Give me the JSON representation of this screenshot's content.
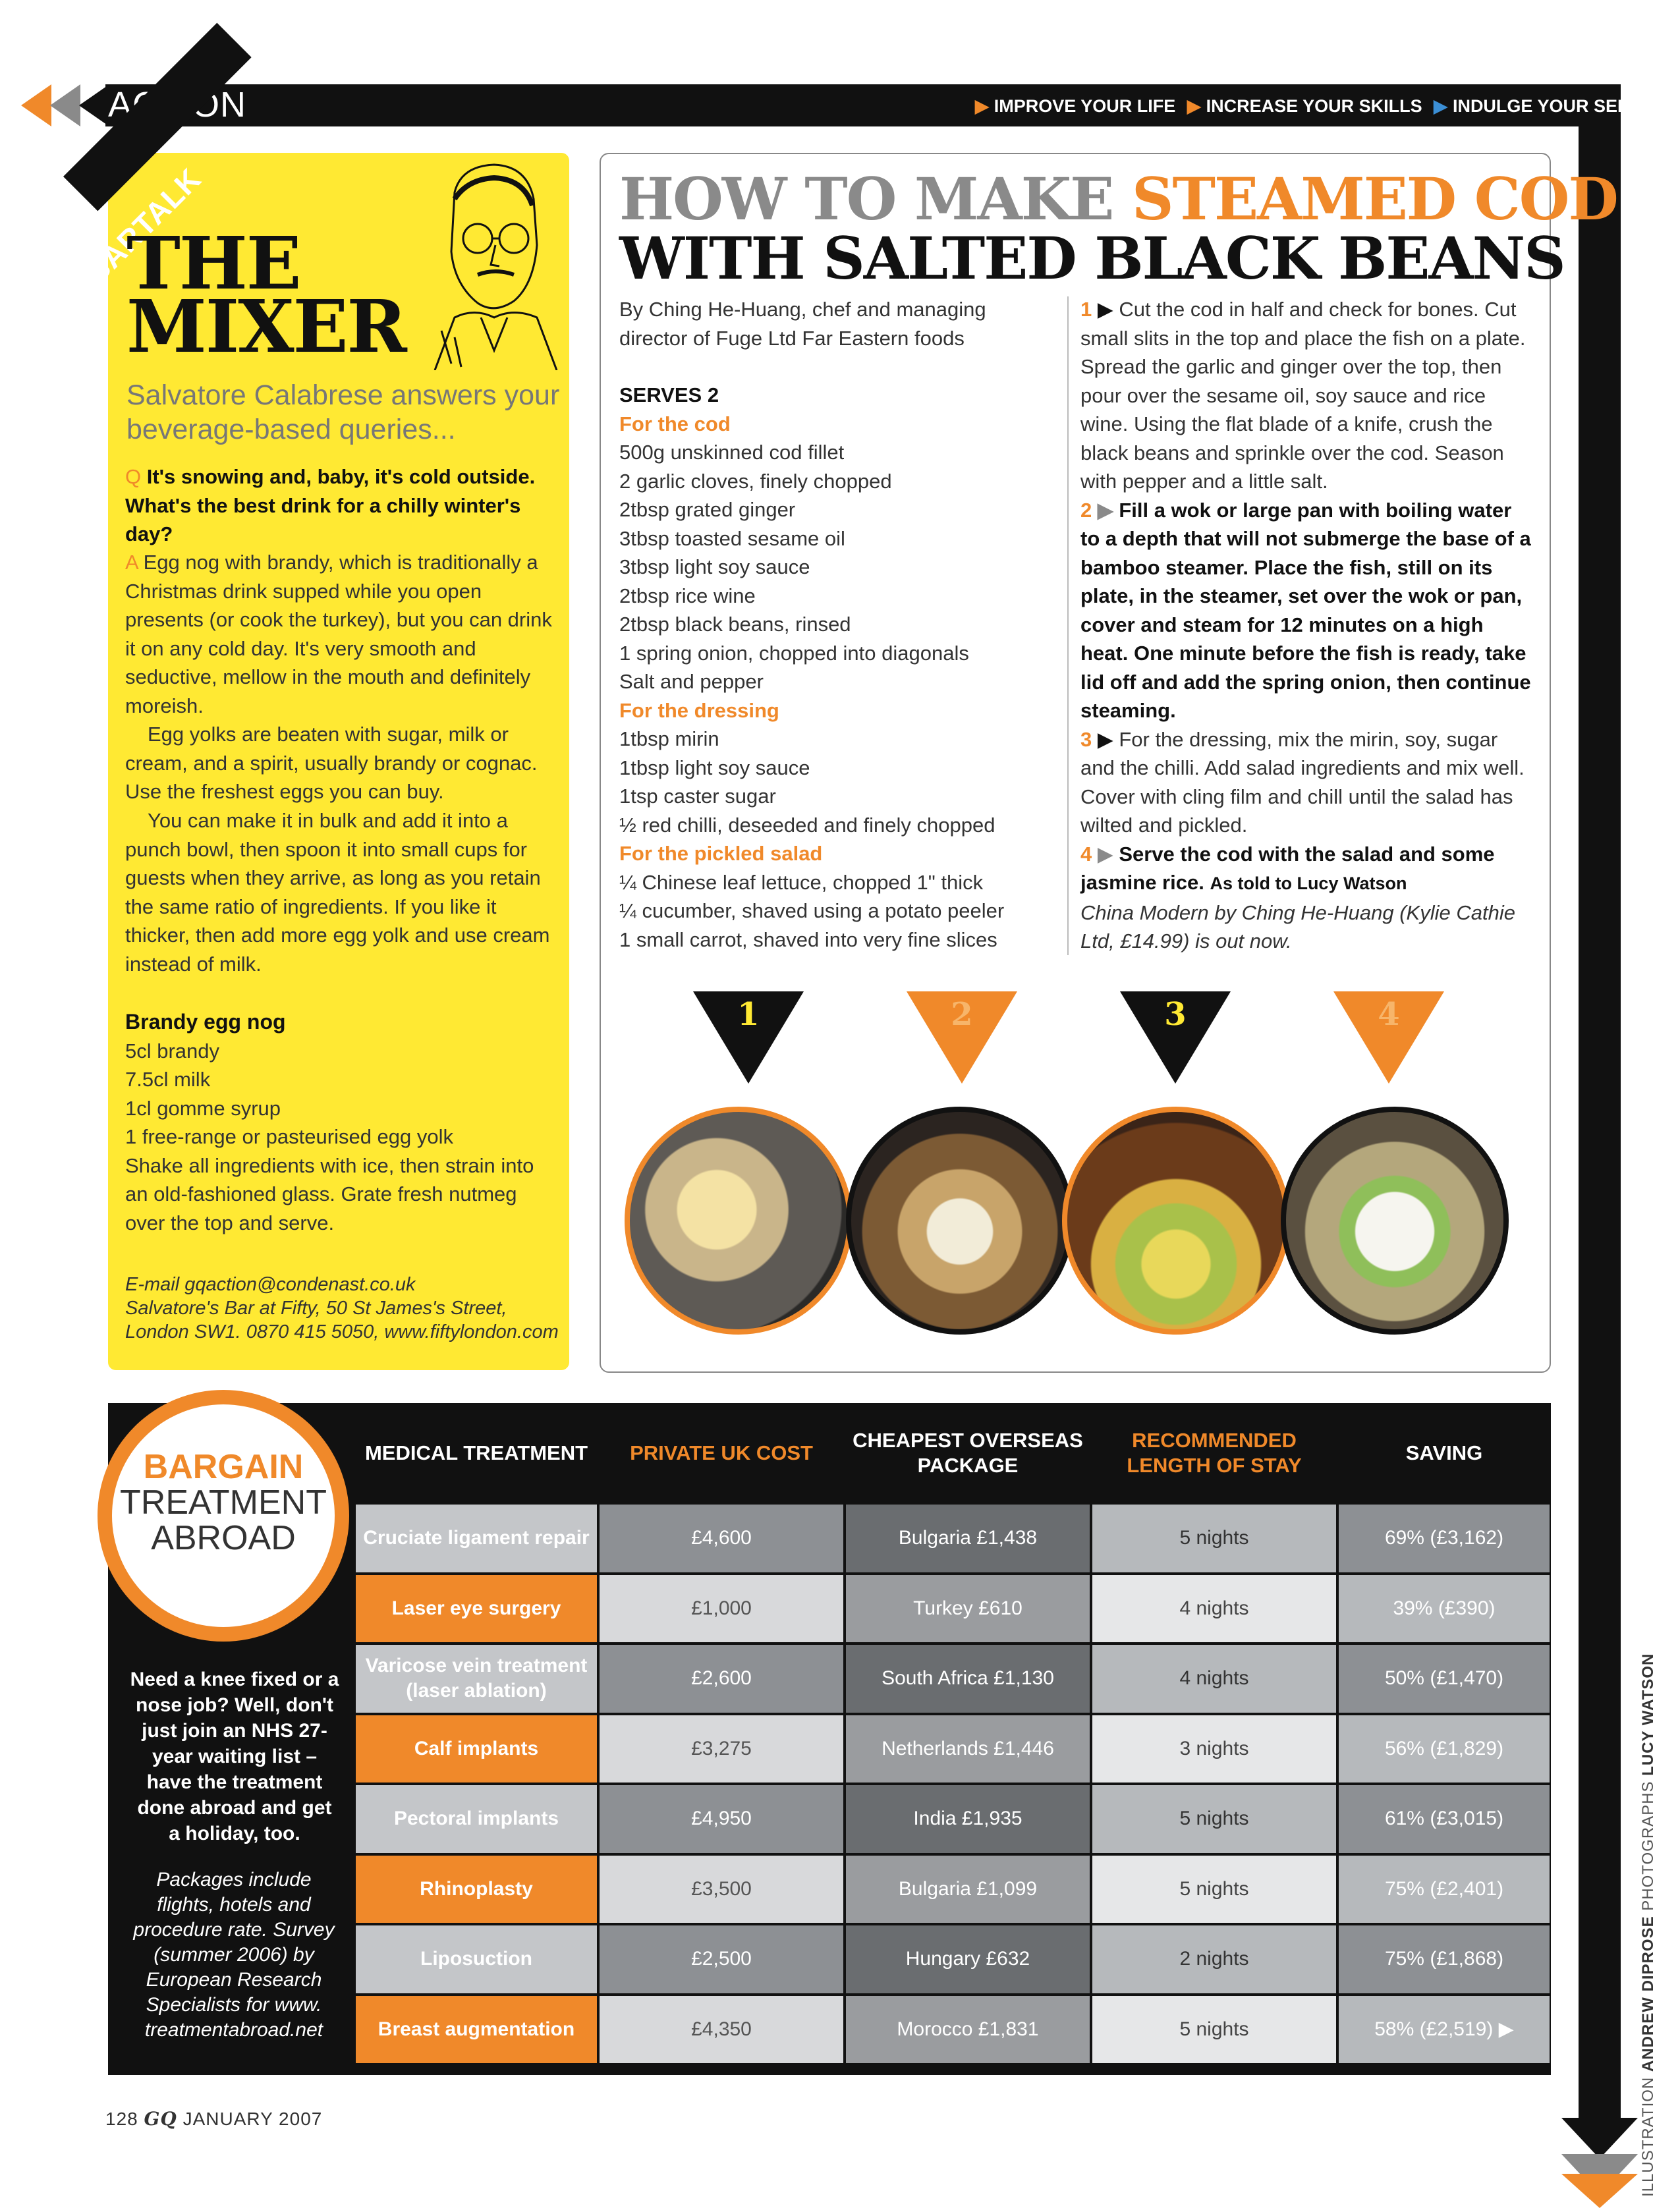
{
  "header": {
    "section": "ACTION",
    "nav": [
      "IMPROVE YOUR LIFE",
      "INCREASE YOUR SKILLS",
      "INDULGE YOUR SENSES"
    ]
  },
  "mixer": {
    "tag": "BARTALK",
    "title_line1": "THE",
    "title_line2": "MIXER",
    "subtitle": "Salvatore Calabrese answers your beverage-based queries...",
    "q_marker": "Q",
    "question": "It's snowing and, baby, it's cold outside. What's the best drink for a chilly winter's day?",
    "a_marker": "A",
    "answer_p1": "Egg nog with brandy, which is traditionally a Christmas drink supped while you open presents (or cook the turkey), but you can drink it on any cold day. It's very smooth and seductive, mellow in the mouth and definitely moreish.",
    "answer_p2": "Egg yolks are beaten with sugar, milk or cream, and a spirit, usually brandy or cognac. Use the freshest eggs you can buy.",
    "answer_p3": "You can make it in bulk and add it into a punch bowl, then spoon it into small cups for guests when they arrive, as long as you retain the same ratio of ingredients. If you like it thicker, then add more egg yolk and use cream instead of milk.",
    "recipe_title": "Brandy egg nog",
    "recipe_lines": [
      "5cl brandy",
      "7.5cl milk",
      "1cl gomme syrup",
      "1 free-range or pasteurised egg yolk",
      "Shake all ingredients with ice, then strain into an old-fashioned glass. Grate fresh nutmeg over the top and serve."
    ],
    "contact_email": "E-mail gqaction@condenast.co.uk",
    "contact_address": "Salvatore's Bar at Fifty, 50 St James's Street, London SW1. 0870 415 5050, www.fiftylondon.com"
  },
  "recipe": {
    "title_part1": "HOW TO MAKE ",
    "title_part2": "STEAMED COD",
    "title_line2": "WITH SALTED BLACK BEANS",
    "byline": "By Ching He-Huang, chef and managing director of Fuge Ltd Far Eastern foods",
    "serves": "SERVES 2",
    "sections": [
      {
        "heading": "For the cod",
        "items": [
          "500g unskinned cod fillet",
          "2 garlic cloves, finely chopped",
          "2tbsp grated ginger",
          "3tbsp toasted sesame oil",
          "3tbsp light soy sauce",
          "2tbsp rice wine",
          "2tbsp black beans, rinsed",
          "1 spring onion, chopped into diagonals",
          "Salt and pepper"
        ]
      },
      {
        "heading": "For the dressing",
        "items": [
          "1tbsp mirin",
          "1tbsp light soy sauce",
          "1tsp caster sugar",
          "½ red chilli, deseeded and finely chopped"
        ]
      },
      {
        "heading": "For the pickled salad",
        "items": [
          "¼ Chinese leaf lettuce, chopped 1\" thick",
          "¼ cucumber, shaved using a potato peeler",
          "1 small carrot, shaved into very fine slices"
        ]
      }
    ],
    "steps": [
      {
        "num": "1",
        "text": "Cut the cod in half and check for bones. Cut small slits in the top and place the fish on a plate. Spread the garlic and ginger over the top, then pour over the sesame oil, soy sauce and rice wine. Using the flat blade of a knife, crush the black beans and sprinkle over the cod. Season with pepper and a little salt."
      },
      {
        "num": "2",
        "text": "Fill a wok or large pan with boiling water to a depth that will not submerge the base of a bamboo steamer. Place the fish, still on its plate, in the steamer, set over the wok or pan, cover and steam for 12 minutes on a high heat. One minute before the fish is ready, take lid off and add the spring onion, then continue steaming."
      },
      {
        "num": "3",
        "text": "For the dressing, mix the mirin, soy, sugar and the chilli. Add salad ingredients and mix well. Cover with cling film and chill until the salad has wilted and pickled."
      },
      {
        "num": "4",
        "text": "Serve the cod with the salad and some jasmine rice."
      }
    ],
    "told_to": "As told to Lucy Watson",
    "book_note": "China Modern by Ching He-Huang (Kylie Cathie Ltd, £14.99) is out now.",
    "photo_steps": [
      "1",
      "2",
      "3",
      "4"
    ]
  },
  "bargain": {
    "badge_line1": "BARGAIN",
    "badge_line2": "TREATMENT",
    "badge_line3": "ABROAD",
    "intro": "Need a knee fixed or a nose job? Well, don't just join an NHS 27-year waiting list – have the treatment done abroad and get a holiday, too.",
    "note": "Packages include flights, hotels and procedure rate. Survey (summer 2006) by European Research Specialists for www. treatmentabroad.net",
    "columns": [
      "MEDICAL TREATMENT",
      "PRIVATE UK COST",
      "CHEAPEST OVERSEAS PACKAGE",
      "RECOMMENDED LENGTH OF STAY",
      "SAVING"
    ],
    "rows": [
      {
        "treatment": "Cruciate ligament repair",
        "uk_cost": "£4,600",
        "package": "Bulgaria £1,438",
        "stay": "5 nights",
        "saving": "69% (£3,162)"
      },
      {
        "treatment": "Laser eye surgery",
        "uk_cost": "£1,000",
        "package": "Turkey £610",
        "stay": "4 nights",
        "saving": "39% (£390)"
      },
      {
        "treatment": "Varicose vein treatment (laser ablation)",
        "uk_cost": "£2,600",
        "package": "South Africa £1,130",
        "stay": "4 nights",
        "saving": "50% (£1,470)"
      },
      {
        "treatment": "Calf implants",
        "uk_cost": "£3,275",
        "package": "Netherlands £1,446",
        "stay": "3 nights",
        "saving": "56% (£1,829)"
      },
      {
        "treatment": "Pectoral implants",
        "uk_cost": "£4,950",
        "package": "India £1,935",
        "stay": "5 nights",
        "saving": "61% (£3,015)"
      },
      {
        "treatment": "Rhinoplasty",
        "uk_cost": "£3,500",
        "package": "Bulgaria £1,099",
        "stay": "5 nights",
        "saving": "75% (£2,401)"
      },
      {
        "treatment": "Liposuction",
        "uk_cost": "£2,500",
        "package": "Hungary £632",
        "stay": "2 nights",
        "saving": "75% (£1,868)"
      },
      {
        "treatment": "Breast augmentation",
        "uk_cost": "£4,350",
        "package": "Morocco £1,831",
        "stay": "5 nights",
        "saving": "58% (£2,519) ▶"
      }
    ]
  },
  "footer": {
    "page": "128",
    "mag": "GQ",
    "date": "JANUARY 2007",
    "credit_illustration_label": "ILLUSTRATION",
    "credit_illustration": "ANDREW DIPROSE",
    "credit_photo_label": "PHOTOGRAPHS",
    "credit_photo": "LUCY WATSON"
  },
  "colors": {
    "accent": "#f0892a",
    "yellow": "#ffe933",
    "black": "#111111",
    "grey": "#8a8a8a"
  }
}
